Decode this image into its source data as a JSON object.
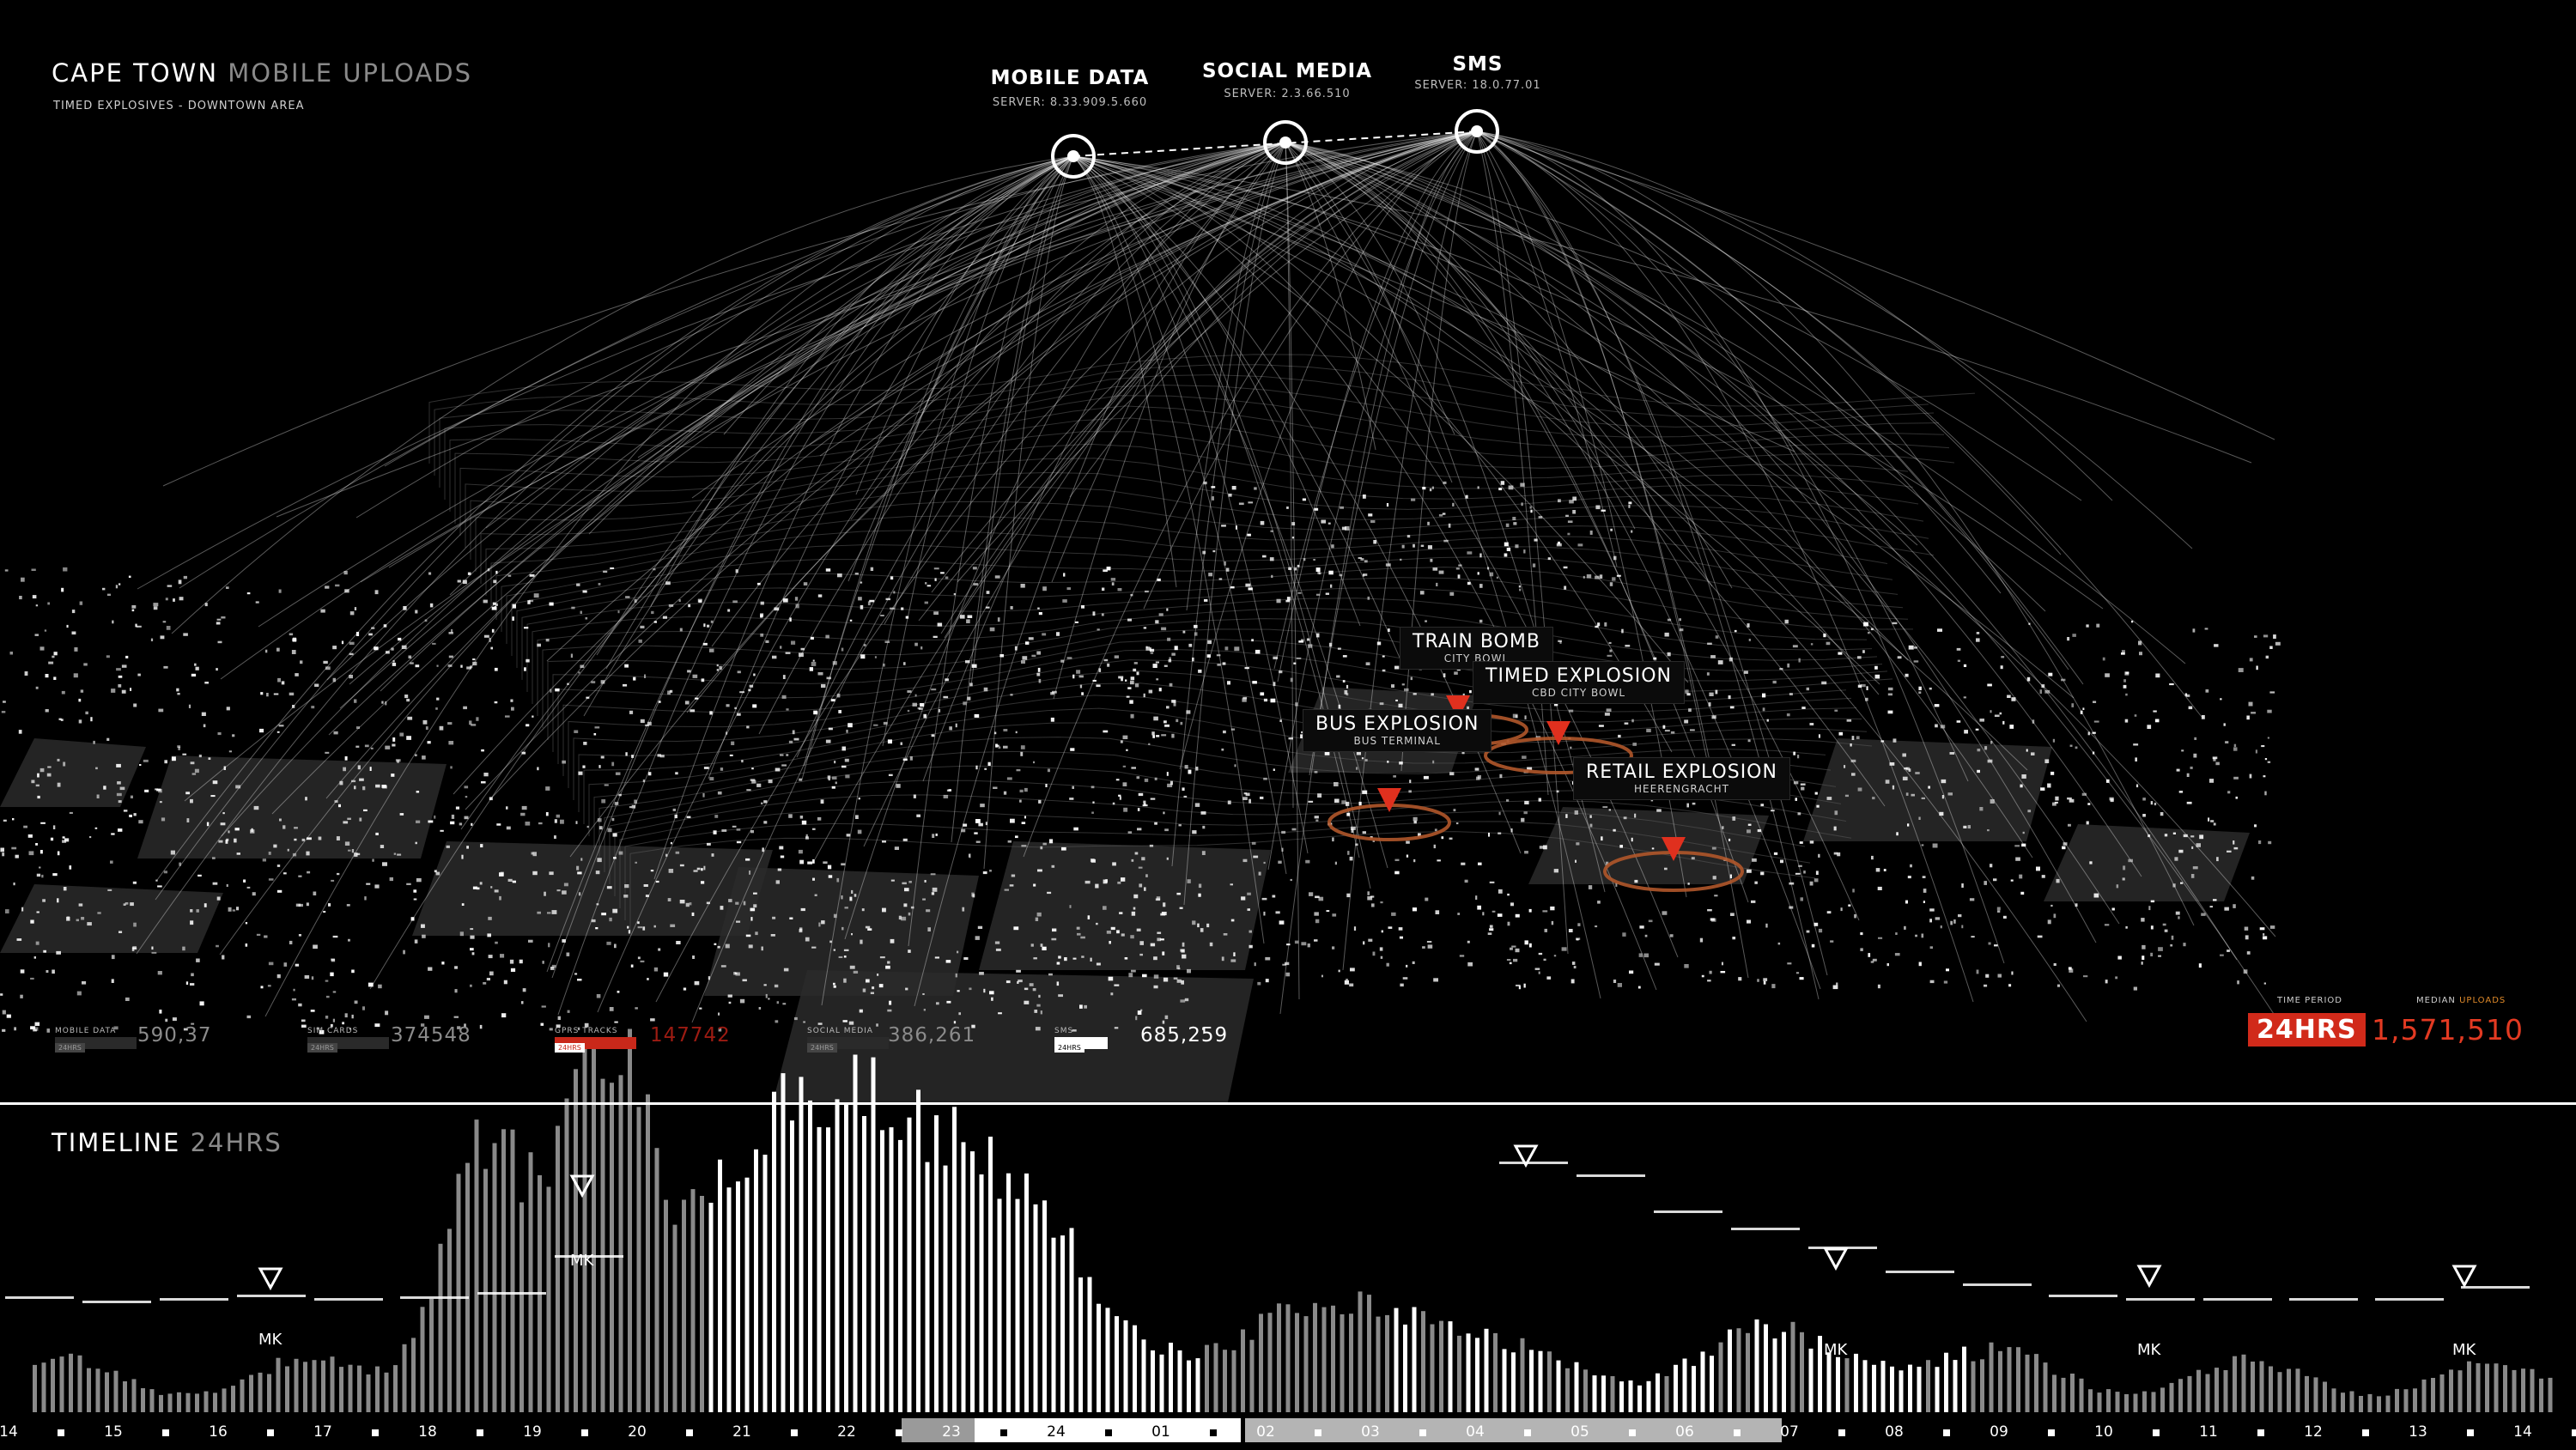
{
  "header": {
    "title_main": "CAPE TOWN",
    "title_dim": "MOBILE UPLOADS",
    "subtitle": "TIMED EXPLOSIVES - DOWNTOWN AREA"
  },
  "sources": [
    {
      "name": "MOBILE DATA",
      "server": "SERVER: 8.33.909.5.660"
    },
    {
      "name": "SOCIAL MEDIA",
      "server": "SERVER: 2.3.66.510"
    },
    {
      "name": "SMS",
      "server": "SERVER: 18.0.77.01"
    }
  ],
  "incidents": [
    {
      "title": "TRAIN BOMB",
      "sub": "CITY BOWL"
    },
    {
      "title": "TIMED EXPLOSION",
      "sub": "CBD CITY BOWL"
    },
    {
      "title": "BUS EXPLOSION",
      "sub": "BUS TERMINAL"
    },
    {
      "title": "RETAIL EXPLOSION",
      "sub": "HEERENGRACHT"
    }
  ],
  "stats": [
    {
      "label": "MOBILE DATA",
      "tag": "24HRS",
      "value": "590,37",
      "color": "#2a2a2a"
    },
    {
      "label": "SIM CARDS",
      "tag": "24HRS",
      "value": "374548",
      "color": "#2a2a2a"
    },
    {
      "label": "GPRS TRACKS",
      "tag": "24HRS",
      "value": "147742",
      "color": "#c9281a"
    },
    {
      "label": "SOCIAL MEDIA",
      "tag": "24HRS",
      "value": "386,261",
      "color": "#2a2a2a"
    },
    {
      "label": "SMS",
      "tag": "24HRS",
      "value": "685,259",
      "color": "#ffffff"
    }
  ],
  "summary": {
    "time_period_label": "TIME PERIOD",
    "median_label_a": "MEDIAN",
    "median_label_b": "UPLOADS",
    "period": "24HRS",
    "median_value": "1,571,510"
  },
  "timeline": {
    "title": "TIMELINE",
    "title_dim": "24HRS",
    "marker_label": "MK",
    "hours": [
      "14",
      "15",
      "16",
      "17",
      "18",
      "19",
      "20",
      "21",
      "22",
      "23",
      "24",
      "01",
      "02",
      "03",
      "04",
      "05",
      "06",
      "07",
      "08",
      "09",
      "10",
      "11",
      "12",
      "13",
      "14"
    ]
  },
  "colors": {
    "accent_red": "#d12a1a",
    "ring_orange": "#b0562a",
    "median_orange": "#e08a2a"
  }
}
